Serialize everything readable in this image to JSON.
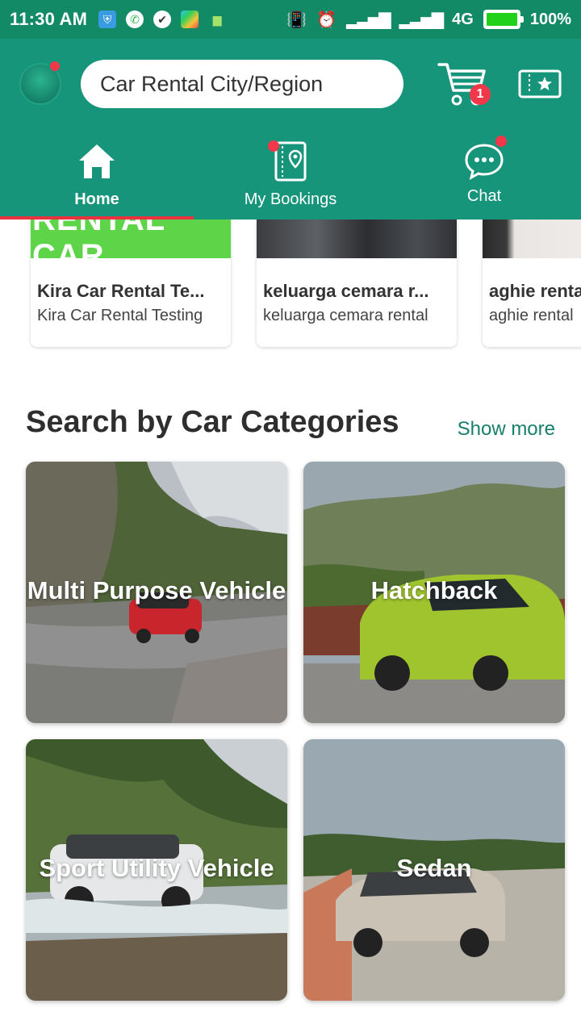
{
  "status_bar": {
    "time": "11:30 AM",
    "network": "4G",
    "battery": "100%",
    "battery_level": 1.0
  },
  "header": {
    "search_placeholder": "Car Rental City/Region",
    "cart_count": "1"
  },
  "nav": {
    "tabs": [
      {
        "label": "Home",
        "icon": "home-icon"
      },
      {
        "label": "My Bookings",
        "icon": "bookings-icon"
      },
      {
        "label": "Chat",
        "icon": "chat-icon"
      }
    ]
  },
  "rentals": [
    {
      "name": "Kira Car Rental Te...",
      "sub": "Kira Car Rental Testing"
    },
    {
      "name": "keluarga cemara r...",
      "sub": "keluarga cemara rental"
    },
    {
      "name": "aghie renta",
      "sub": "aghie rental"
    }
  ],
  "section": {
    "title": "Search by Car Categories",
    "show_more": "Show more"
  },
  "categories": [
    {
      "label": "Multi Purpose Vehicle"
    },
    {
      "label": "Hatchback"
    },
    {
      "label": "Sport Utility Vehicle"
    },
    {
      "label": "Sedan"
    }
  ],
  "colors": {
    "primary": "#17957a",
    "status_bar": "#128a66",
    "accent_red": "#e8323f",
    "link": "#16806a"
  }
}
